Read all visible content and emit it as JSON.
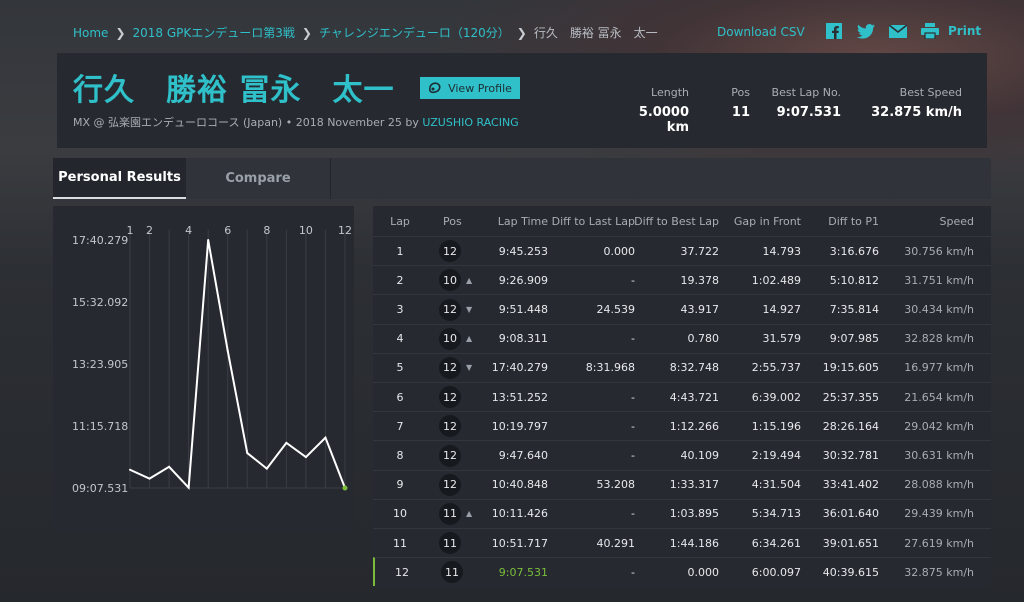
{
  "breadcrumbs": [
    "Home",
    "2018 GPKエンデューロ第3戦",
    "チャレンジエンデューロ（120分）",
    "行久　勝裕 冨永　太一"
  ],
  "download_csv": "Download CSV",
  "print_label": "Print",
  "share_icons": [
    "facebook-icon",
    "twitter-icon",
    "mail-icon",
    "print-icon"
  ],
  "rider": {
    "name": "行久　勝裕 冨永　太一",
    "view_profile": "View Profile",
    "sub_prefix": "MX @ 弘楽園エンデューロコース (Japan) • 2018 November 25 by ",
    "team": "UZUSHIO RACING"
  },
  "stats": [
    {
      "label": "Length",
      "value": "5.0000 km"
    },
    {
      "label": "Pos",
      "value": "11"
    },
    {
      "label": "Best Lap No.",
      "value": "9:07.531"
    },
    {
      "label": "Best Speed",
      "value": "32.875 km/h"
    }
  ],
  "tabs": [
    "Personal Results",
    "Compare"
  ],
  "table": {
    "headers": [
      "Lap",
      "Pos",
      "Lap Time",
      "Diff to Last Lap",
      "Diff to Best Lap",
      "Gap in Front",
      "Diff to P1",
      "Speed"
    ],
    "rows": [
      {
        "lap": "1",
        "pos": "12",
        "trend": "",
        "laptime": "9:45.253",
        "dlast": "0.000",
        "dbest": "37.722",
        "front": "14.793",
        "p1": "3:16.676",
        "speed": "30.756 km/h"
      },
      {
        "lap": "2",
        "pos": "10",
        "trend": "up",
        "laptime": "9:26.909",
        "dlast": "-",
        "dbest": "19.378",
        "front": "1:02.489",
        "p1": "5:10.812",
        "speed": "31.751 km/h"
      },
      {
        "lap": "3",
        "pos": "12",
        "trend": "down",
        "laptime": "9:51.448",
        "dlast": "24.539",
        "dbest": "43.917",
        "front": "14.927",
        "p1": "7:35.814",
        "speed": "30.434 km/h"
      },
      {
        "lap": "4",
        "pos": "10",
        "trend": "up",
        "laptime": "9:08.311",
        "dlast": "-",
        "dbest": "0.780",
        "front": "31.579",
        "p1": "9:07.985",
        "speed": "32.828 km/h"
      },
      {
        "lap": "5",
        "pos": "12",
        "trend": "down",
        "laptime": "17:40.279",
        "dlast": "8:31.968",
        "dbest": "8:32.748",
        "front": "2:55.737",
        "p1": "19:15.605",
        "speed": "16.977 km/h"
      },
      {
        "lap": "6",
        "pos": "12",
        "trend": "",
        "laptime": "13:51.252",
        "dlast": "-",
        "dbest": "4:43.721",
        "front": "6:39.002",
        "p1": "25:37.355",
        "speed": "21.654 km/h"
      },
      {
        "lap": "7",
        "pos": "12",
        "trend": "",
        "laptime": "10:19.797",
        "dlast": "-",
        "dbest": "1:12.266",
        "front": "1:15.196",
        "p1": "28:26.164",
        "speed": "29.042 km/h"
      },
      {
        "lap": "8",
        "pos": "12",
        "trend": "",
        "laptime": "9:47.640",
        "dlast": "-",
        "dbest": "40.109",
        "front": "2:19.494",
        "p1": "30:32.781",
        "speed": "30.631 km/h"
      },
      {
        "lap": "9",
        "pos": "12",
        "trend": "",
        "laptime": "10:40.848",
        "dlast": "53.208",
        "dbest": "1:33.317",
        "front": "4:31.504",
        "p1": "33:41.402",
        "speed": "28.088 km/h"
      },
      {
        "lap": "10",
        "pos": "11",
        "trend": "up",
        "laptime": "10:11.426",
        "dlast": "-",
        "dbest": "1:03.895",
        "front": "5:34.713",
        "p1": "36:01.640",
        "speed": "29.439 km/h"
      },
      {
        "lap": "11",
        "pos": "11",
        "trend": "",
        "laptime": "10:51.717",
        "dlast": "40.291",
        "dbest": "1:44.186",
        "front": "6:34.261",
        "p1": "39:01.651",
        "speed": "27.619 km/h"
      },
      {
        "lap": "12",
        "pos": "11",
        "trend": "",
        "laptime": "9:07.531",
        "dlast": "-",
        "dbest": "0.000",
        "front": "6:00.097",
        "p1": "40:39.615",
        "speed": "32.875 km/h",
        "best": true
      }
    ]
  },
  "chart_data": {
    "type": "line",
    "x_ticks": [
      "1",
      "2",
      "4",
      "6",
      "8",
      "10",
      "12"
    ],
    "y_ticks": [
      "17:40.279",
      "15:32.092",
      "13:23.905",
      "11:15.718",
      "09:07.531"
    ],
    "ylim_seconds": [
      547.531,
      1060.279
    ],
    "x": [
      1,
      2,
      3,
      4,
      5,
      6,
      7,
      8,
      9,
      10,
      11,
      12
    ],
    "values_seconds": [
      585.253,
      566.909,
      591.448,
      548.311,
      1060.279,
      831.252,
      619.797,
      587.64,
      640.848,
      611.426,
      651.717,
      547.531
    ],
    "line_color": "#ffffff",
    "best_color": "#7bbd3a"
  }
}
